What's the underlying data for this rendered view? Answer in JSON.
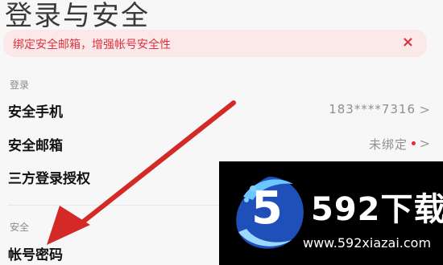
{
  "header": {
    "title": "登录与安全"
  },
  "banner": {
    "text": "绑定安全邮箱，增强帐号安全性",
    "close_glyph": "×"
  },
  "sections": {
    "login_label": "登录",
    "security_label": "安全"
  },
  "rows": {
    "phone": {
      "label": "安全手机",
      "value": "183****7316"
    },
    "email": {
      "label": "安全邮箱",
      "value": "未绑定"
    },
    "third_party": {
      "label": "三方登录授权"
    },
    "password": {
      "label": "帐号密码"
    }
  },
  "chevron_glyph": ">",
  "watermark": {
    "brand": "592下载",
    "url": "www.592xiazai.com",
    "logo_glyph": "5"
  },
  "colors": {
    "accent_red": "#d9333f",
    "banner_bg": "#fbe9ea",
    "arrow_red": "#d42a27"
  }
}
